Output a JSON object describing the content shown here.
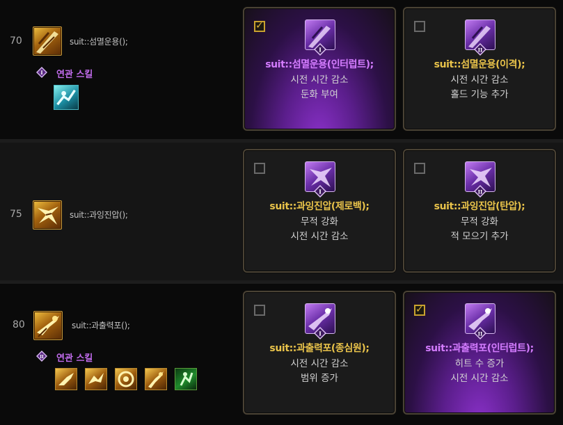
{
  "rows": [
    {
      "level": "70",
      "skill_name": "suit::섬멸운용();",
      "related_label": "연관 스킬",
      "related_tier": "I",
      "related_icons": [
        "teal"
      ],
      "options": [
        {
          "tier": "I",
          "checked": true,
          "title": "suit::섬멸운용(인터럽트);",
          "lines": [
            "시전 시간 감소",
            "둔화 부여"
          ]
        },
        {
          "tier": "II",
          "checked": false,
          "title": "suit::섬멸운용(이격);",
          "lines": [
            "시전 시간 감소",
            "홀드 기능 추가"
          ]
        }
      ]
    },
    {
      "level": "75",
      "skill_name": "suit::과잉진압();",
      "options": [
        {
          "tier": "I",
          "checked": false,
          "title": "suit::과잉진압(제로백);",
          "lines": [
            "무적 강화",
            "시전 시간 감소"
          ]
        },
        {
          "tier": "II",
          "checked": false,
          "title": "suit::과잉진압(탄압);",
          "lines": [
            "무적 강화",
            "적 모으기 추가"
          ]
        }
      ]
    },
    {
      "level": "80",
      "skill_name": "suit::과출력포();",
      "related_label": "연관 스킬",
      "related_tier": "II",
      "related_icons": [
        "gold",
        "gold",
        "gold",
        "gold",
        "green"
      ],
      "options": [
        {
          "tier": "I",
          "checked": false,
          "title": "suit::과출력포(종심원);",
          "lines": [
            "시전 시간 감소",
            "범위 증가"
          ]
        },
        {
          "tier": "II",
          "checked": true,
          "title": "suit::과출력포(인터럽트);",
          "lines": [
            "히트 수 증가",
            "시전 시간 감소"
          ]
        }
      ]
    }
  ],
  "icons": {
    "checkbox": "check-icon",
    "tier_badge": "diamond-roman-icon"
  },
  "colors": {
    "gold_title": "#e9c34a",
    "purple_title": "#d47cff",
    "related_label": "#c46df0"
  }
}
